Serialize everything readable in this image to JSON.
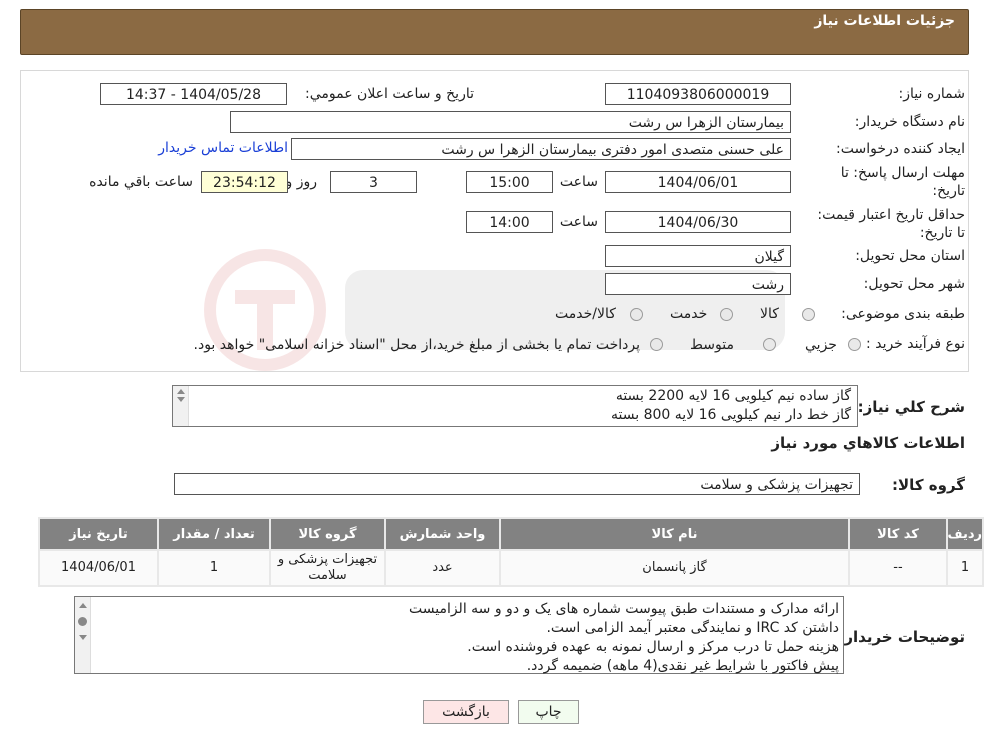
{
  "header": {
    "title": "جزئیات اطلاعات نیاز"
  },
  "form": {
    "need_number_label": "شماره نیاز:",
    "need_number": "1104093806000019",
    "announce_label": "تاریخ و ساعت اعلان عمومي:",
    "announce_value": "1404/05/28 - 14:37",
    "buyer_label": "نام دستگاه خریدار:",
    "buyer_value": "بیمارستان الزهرا  س  رشت",
    "creator_label": "ایجاد کننده درخواست:",
    "creator_value": "علی حسنی متصدی امور دفتری بیمارستان الزهرا  س  رشت",
    "contact_link": "اطلاعات تماس خریدار",
    "deadline_label": "مهلت ارسال پاسخ: تا تاریخ:",
    "deadline_date": "1404/06/01",
    "time_label": "ساعت",
    "deadline_time": "15:00",
    "deadline_days": "3",
    "days_label": "روز و",
    "deadline_remaining": "23:54:12",
    "remaining_label": "ساعت باقي مانده",
    "validity_label": "حداقل تاریخ اعتبار قیمت: تا تاریخ:",
    "validity_date": "1404/06/30",
    "validity_time": "14:00",
    "province_label": "استان محل تحویل:",
    "province_value": "گیلان",
    "city_label": "شهر محل تحویل:",
    "city_value": "رشت",
    "category_label": "طبقه بندی موضوعی:",
    "category_options": [
      "کالا",
      "خدمت",
      "کالا/خدمت"
    ],
    "process_label": "نوع فرآیند خرید :",
    "process_options": [
      "جزیي",
      "متوسط"
    ],
    "process_note": "پرداخت تمام یا بخشی از مبلغ خرید،از محل \"اسناد خزانه اسلامی\" خواهد بود."
  },
  "description": {
    "label": "شرح کلي نیاز:",
    "lines": [
      "گاز ساده نیم کیلویی 16 لایه 2200 بسته",
      "گاز خط دار نیم کیلویی 16 لایه 800 بسته"
    ]
  },
  "goods_section": {
    "title": "اطلاعات کالاهاي مورد نیاز",
    "group_label": "گروه کالا:",
    "group_value": "تجهیزات پزشکی و سلامت"
  },
  "table": {
    "headers": [
      "ردیف",
      "کد کالا",
      "نام کالا",
      "واحد شمارش",
      "گروه کالا",
      "تعداد / مقدار",
      "تاریخ نیاز"
    ],
    "rows": [
      [
        "1",
        "--",
        "گاز پانسمان",
        "عدد",
        "تجهیزات پزشکی و سلامت",
        "1",
        "1404/06/01"
      ]
    ]
  },
  "buyer_notes": {
    "label": "توضیحات خریدار:",
    "lines": [
      "ارائه مدارک و مستندات طبق پیوست شماره های یک و دو و سه الزامیست",
      "داشتن کد IRC و نمایندگی معتبر آیمد الزامی است.",
      "هزینه حمل تا درب مرکز و ارسال نمونه به عهده فروشنده است.",
      "پیش فاکتور با شرایط غیر نقدی(4 ماهه) ضمیمه گردد."
    ]
  },
  "buttons": {
    "print": "چاپ",
    "back": "بازگشت"
  },
  "colors": {
    "header_bg": "#8b6a43",
    "table_header_bg": "#828282",
    "link": "#1a3fd6"
  }
}
